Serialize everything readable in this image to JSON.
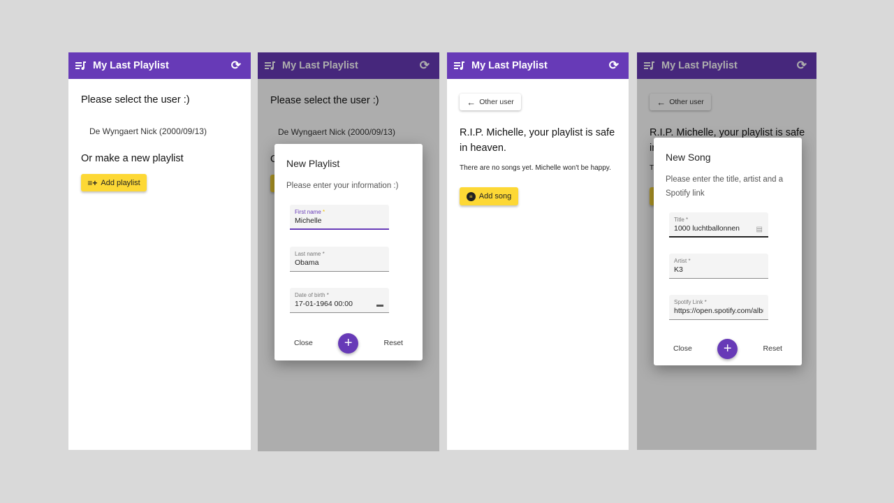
{
  "app_title": "My Last Playlist",
  "colors": {
    "primary": "#673ab7",
    "accent": "#fdd835"
  },
  "select_screen": {
    "heading": "Please select the user :)",
    "users": [
      "De Wyngaert Nick (2000/09/13)"
    ],
    "new_heading": "Or make a new playlist",
    "add_playlist": "Add playlist"
  },
  "new_playlist_dialog": {
    "title": "New Playlist",
    "subtitle": "Please enter your information :)",
    "fields": [
      {
        "label": "First name",
        "required": "*",
        "value": "Michelle"
      },
      {
        "label": "Last name *",
        "value": "Obama"
      },
      {
        "label": "Date of birth *",
        "value": "17-01-1964 00:00"
      }
    ],
    "close": "Close",
    "submit": "+",
    "reset": "Reset"
  },
  "playlist_screen": {
    "back": "Other user",
    "heading": "R.I.P. Michelle, your playlist is safe in heaven.",
    "empty": "There are no songs yet. Michelle won't be happy.",
    "add_song": "Add song"
  },
  "new_song_dialog": {
    "title": "New Song",
    "subtitle": "Please enter the title, artist and a Spotify link",
    "fields": [
      {
        "label": "Title *",
        "value": "1000 luchtballonnen"
      },
      {
        "label": "Artist *",
        "value": "K3"
      },
      {
        "label": "Spotify Link *",
        "value": "https://open.spotify.com/album"
      }
    ],
    "close": "Close",
    "submit": "+",
    "reset": "Reset"
  },
  "icons": {
    "logo": "playlist-music-icon",
    "refresh": "refresh-icon",
    "add_playlist": "playlist-add-icon",
    "back": "arrow-left-icon",
    "add_song": "music-add-icon",
    "calendar": "calendar-icon",
    "autofill": "contact-card-icon"
  }
}
